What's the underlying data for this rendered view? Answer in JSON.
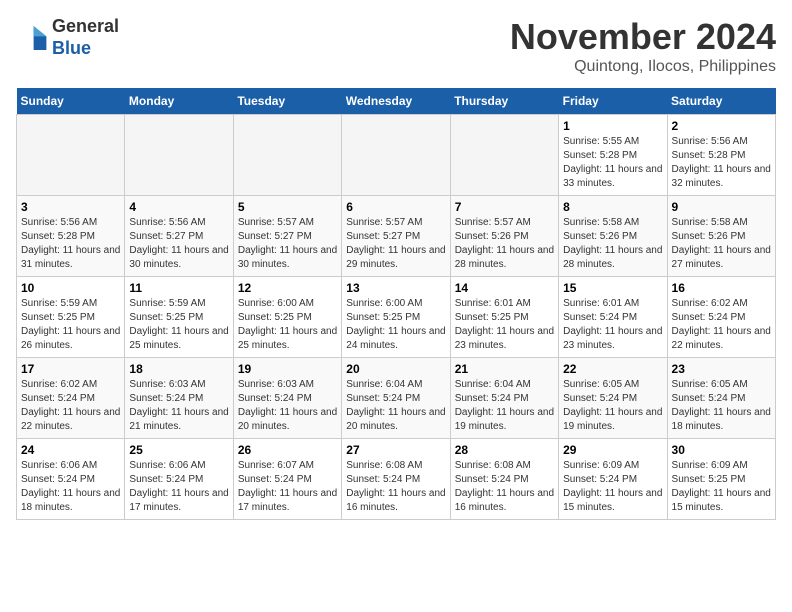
{
  "header": {
    "logo_line1": "General",
    "logo_line2": "Blue",
    "month": "November 2024",
    "location": "Quintong, Ilocos, Philippines"
  },
  "weekdays": [
    "Sunday",
    "Monday",
    "Tuesday",
    "Wednesday",
    "Thursday",
    "Friday",
    "Saturday"
  ],
  "weeks": [
    [
      {
        "day": "",
        "info": ""
      },
      {
        "day": "",
        "info": ""
      },
      {
        "day": "",
        "info": ""
      },
      {
        "day": "",
        "info": ""
      },
      {
        "day": "",
        "info": ""
      },
      {
        "day": "1",
        "info": "Sunrise: 5:55 AM\nSunset: 5:28 PM\nDaylight: 11 hours and 33 minutes."
      },
      {
        "day": "2",
        "info": "Sunrise: 5:56 AM\nSunset: 5:28 PM\nDaylight: 11 hours and 32 minutes."
      }
    ],
    [
      {
        "day": "3",
        "info": "Sunrise: 5:56 AM\nSunset: 5:28 PM\nDaylight: 11 hours and 31 minutes."
      },
      {
        "day": "4",
        "info": "Sunrise: 5:56 AM\nSunset: 5:27 PM\nDaylight: 11 hours and 30 minutes."
      },
      {
        "day": "5",
        "info": "Sunrise: 5:57 AM\nSunset: 5:27 PM\nDaylight: 11 hours and 30 minutes."
      },
      {
        "day": "6",
        "info": "Sunrise: 5:57 AM\nSunset: 5:27 PM\nDaylight: 11 hours and 29 minutes."
      },
      {
        "day": "7",
        "info": "Sunrise: 5:57 AM\nSunset: 5:26 PM\nDaylight: 11 hours and 28 minutes."
      },
      {
        "day": "8",
        "info": "Sunrise: 5:58 AM\nSunset: 5:26 PM\nDaylight: 11 hours and 28 minutes."
      },
      {
        "day": "9",
        "info": "Sunrise: 5:58 AM\nSunset: 5:26 PM\nDaylight: 11 hours and 27 minutes."
      }
    ],
    [
      {
        "day": "10",
        "info": "Sunrise: 5:59 AM\nSunset: 5:25 PM\nDaylight: 11 hours and 26 minutes."
      },
      {
        "day": "11",
        "info": "Sunrise: 5:59 AM\nSunset: 5:25 PM\nDaylight: 11 hours and 25 minutes."
      },
      {
        "day": "12",
        "info": "Sunrise: 6:00 AM\nSunset: 5:25 PM\nDaylight: 11 hours and 25 minutes."
      },
      {
        "day": "13",
        "info": "Sunrise: 6:00 AM\nSunset: 5:25 PM\nDaylight: 11 hours and 24 minutes."
      },
      {
        "day": "14",
        "info": "Sunrise: 6:01 AM\nSunset: 5:25 PM\nDaylight: 11 hours and 23 minutes."
      },
      {
        "day": "15",
        "info": "Sunrise: 6:01 AM\nSunset: 5:24 PM\nDaylight: 11 hours and 23 minutes."
      },
      {
        "day": "16",
        "info": "Sunrise: 6:02 AM\nSunset: 5:24 PM\nDaylight: 11 hours and 22 minutes."
      }
    ],
    [
      {
        "day": "17",
        "info": "Sunrise: 6:02 AM\nSunset: 5:24 PM\nDaylight: 11 hours and 22 minutes."
      },
      {
        "day": "18",
        "info": "Sunrise: 6:03 AM\nSunset: 5:24 PM\nDaylight: 11 hours and 21 minutes."
      },
      {
        "day": "19",
        "info": "Sunrise: 6:03 AM\nSunset: 5:24 PM\nDaylight: 11 hours and 20 minutes."
      },
      {
        "day": "20",
        "info": "Sunrise: 6:04 AM\nSunset: 5:24 PM\nDaylight: 11 hours and 20 minutes."
      },
      {
        "day": "21",
        "info": "Sunrise: 6:04 AM\nSunset: 5:24 PM\nDaylight: 11 hours and 19 minutes."
      },
      {
        "day": "22",
        "info": "Sunrise: 6:05 AM\nSunset: 5:24 PM\nDaylight: 11 hours and 19 minutes."
      },
      {
        "day": "23",
        "info": "Sunrise: 6:05 AM\nSunset: 5:24 PM\nDaylight: 11 hours and 18 minutes."
      }
    ],
    [
      {
        "day": "24",
        "info": "Sunrise: 6:06 AM\nSunset: 5:24 PM\nDaylight: 11 hours and 18 minutes."
      },
      {
        "day": "25",
        "info": "Sunrise: 6:06 AM\nSunset: 5:24 PM\nDaylight: 11 hours and 17 minutes."
      },
      {
        "day": "26",
        "info": "Sunrise: 6:07 AM\nSunset: 5:24 PM\nDaylight: 11 hours and 17 minutes."
      },
      {
        "day": "27",
        "info": "Sunrise: 6:08 AM\nSunset: 5:24 PM\nDaylight: 11 hours and 16 minutes."
      },
      {
        "day": "28",
        "info": "Sunrise: 6:08 AM\nSunset: 5:24 PM\nDaylight: 11 hours and 16 minutes."
      },
      {
        "day": "29",
        "info": "Sunrise: 6:09 AM\nSunset: 5:24 PM\nDaylight: 11 hours and 15 minutes."
      },
      {
        "day": "30",
        "info": "Sunrise: 6:09 AM\nSunset: 5:25 PM\nDaylight: 11 hours and 15 minutes."
      }
    ]
  ]
}
